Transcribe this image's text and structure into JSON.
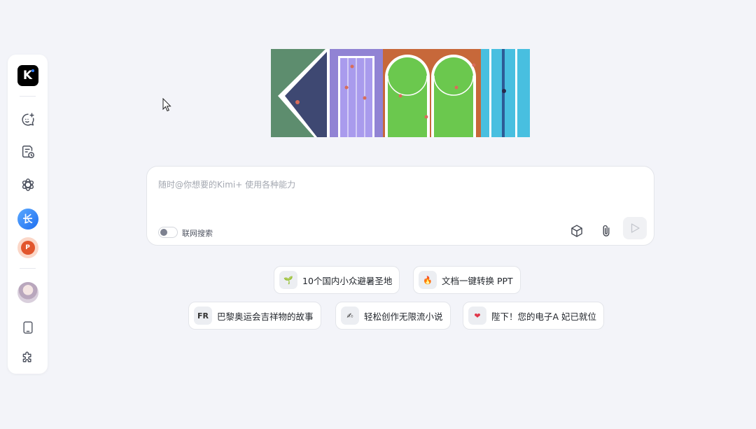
{
  "sidebar": {
    "logo_letter": "K",
    "items": [
      {
        "name": "new-chat-icon"
      },
      {
        "name": "history-icon"
      },
      {
        "name": "explore-icon"
      },
      {
        "name": "kimi-plus-long-text",
        "label": "长"
      },
      {
        "name": "kimi-plus-ppt",
        "label": "P"
      },
      {
        "name": "user-avatar"
      },
      {
        "name": "mobile-icon"
      },
      {
        "name": "plugin-icon"
      }
    ]
  },
  "input": {
    "placeholder": "随时@你想要的Kimi+ 使用各种能力",
    "web_search_label": "联网搜索"
  },
  "suggestions": [
    {
      "icon": "🌱",
      "label": "10个国内小众避暑圣地"
    },
    {
      "icon": "🔥",
      "label": "文档一键转换 PPT"
    },
    {
      "icon": "FR",
      "label": "巴黎奥运会吉祥物的故事"
    },
    {
      "icon": "✍",
      "label": "轻松创作无限流小说"
    },
    {
      "icon": "❤",
      "label": "陛下！您的电子A 妃已就位"
    }
  ],
  "colors": {
    "background": "#f3f4f9",
    "accent": "#2d7cff"
  }
}
